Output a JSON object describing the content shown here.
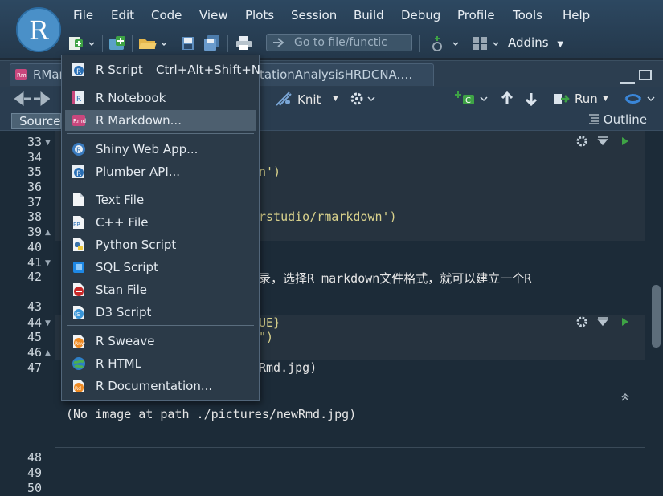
{
  "app": {
    "logo_letter": "R"
  },
  "menubar": [
    "File",
    "Edit",
    "Code",
    "View",
    "Plots",
    "Session",
    "Build",
    "Debug",
    "Profile",
    "Tools",
    "Help"
  ],
  "toolbar": {
    "goto_placeholder": "Go to file/functic",
    "addins_label": "Addins"
  },
  "tabs": [
    {
      "label": "RMar"
    },
    {
      "label": "tationAnalysisHRDCNA.…"
    }
  ],
  "editor_toolbar": {
    "knit_label": "Knit",
    "run_label": "Run"
  },
  "source_bar": {
    "source_label": "Source",
    "outline_label": "Outline"
  },
  "editor": {
    "line_numbers_top": [
      "33",
      "34",
      "35",
      "36",
      "37",
      "38",
      "39",
      "40",
      "41",
      "42",
      "43",
      "44",
      "45",
      "46",
      "47"
    ],
    "line_numbers_bottom": [
      "48",
      "49",
      "50"
    ],
    "visible_code": [
      {
        "line": "35",
        "text": "n')"
      },
      {
        "line": "38",
        "text": "rstudio/rmarkdown')"
      },
      {
        "line": "42",
        "text": "录，选择R markdown文件格式，就可以建立一个R"
      },
      {
        "line": "44",
        "text": "UE}"
      },
      {
        "line": "45",
        "text": "\")"
      },
      {
        "line": "47",
        "text": "Rmd.jpg)"
      }
    ],
    "output_message": "(No image at path ./pictures/newRmd.jpg)"
  },
  "new_file_menu": {
    "items": [
      {
        "label": "R Script",
        "shortcut": "Ctrl+Alt+Shift+N",
        "icon": "r-script-icon"
      },
      {
        "label": "R Notebook",
        "icon": "r-notebook-icon"
      },
      {
        "label": "R Markdown...",
        "icon": "r-markdown-icon",
        "highlighted": true
      },
      {
        "label": "Shiny Web App...",
        "icon": "shiny-icon"
      },
      {
        "label": "Plumber API...",
        "icon": "plumber-icon"
      },
      {
        "label": "Text File",
        "icon": "text-file-icon"
      },
      {
        "label": "C++ File",
        "icon": "cpp-file-icon"
      },
      {
        "label": "Python Script",
        "icon": "python-icon"
      },
      {
        "label": "SQL Script",
        "icon": "sql-icon"
      },
      {
        "label": "Stan File",
        "icon": "stan-icon"
      },
      {
        "label": "D3 Script",
        "icon": "d3-icon"
      },
      {
        "label": "R Sweave",
        "icon": "sweave-icon"
      },
      {
        "label": "R HTML",
        "icon": "r-html-icon"
      },
      {
        "label": "R Documentation...",
        "icon": "r-doc-icon"
      }
    ]
  },
  "colors": {
    "accent": "#4a90c8",
    "menu_bg": "#2b3a48",
    "highlight": "#4d5f6f",
    "editor_bg": "#1c2b38",
    "string": "#d9d28c"
  }
}
